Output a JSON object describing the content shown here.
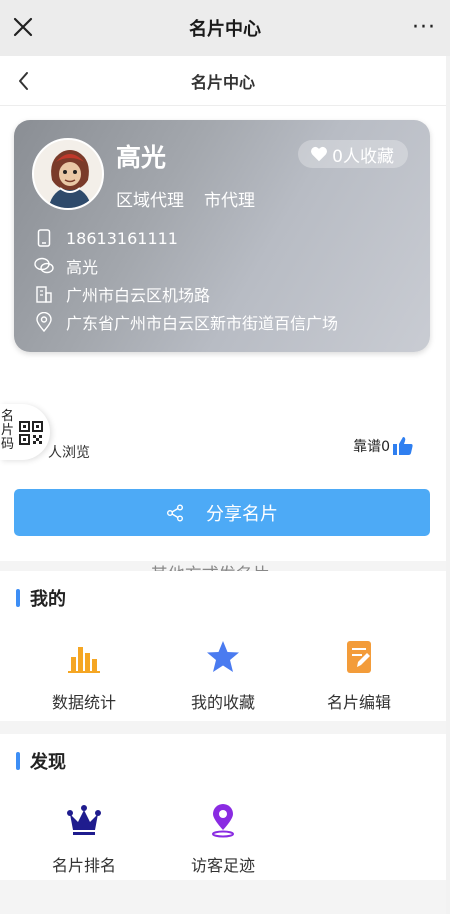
{
  "window": {
    "title": "名片中心",
    "close_icon": "close-icon",
    "more_label": "···"
  },
  "nav": {
    "title": "名片中心",
    "back_icon": "chevron-left-icon"
  },
  "card": {
    "name": "高光",
    "favorites_label": "0人收藏",
    "roles": [
      "区域代理",
      "市代理"
    ],
    "phone": "18613161111",
    "wechat": "高光",
    "company": "广州市白云区机场路",
    "address": "广东省广州市白云区新市街道百信广场"
  },
  "qr_badge": {
    "label": "名片码"
  },
  "stats": {
    "views_label": "人浏览",
    "reliable_label": "靠谱0"
  },
  "actions": {
    "share_label": "分享名片",
    "other_ways_label": "其他方式发名片"
  },
  "mine": {
    "title": "我的",
    "items": [
      {
        "label": "数据统计",
        "icon": "bar-chart-icon"
      },
      {
        "label": "我的收藏",
        "icon": "star-icon"
      },
      {
        "label": "名片编辑",
        "icon": "edit-doc-icon"
      }
    ]
  },
  "discover": {
    "title": "发现",
    "items": [
      {
        "label": "名片排名",
        "icon": "crown-icon"
      },
      {
        "label": "访客足迹",
        "icon": "location-pin-icon"
      }
    ]
  },
  "colors": {
    "accent": "#4daaf6",
    "section_bar": "#3d8ef5",
    "stats_orange": "#f5a623",
    "star_blue": "#4a7bf0",
    "edit_orange": "#f39c3a",
    "crown_navy": "#1f1c8e",
    "pin_purple": "#8a2be2"
  }
}
